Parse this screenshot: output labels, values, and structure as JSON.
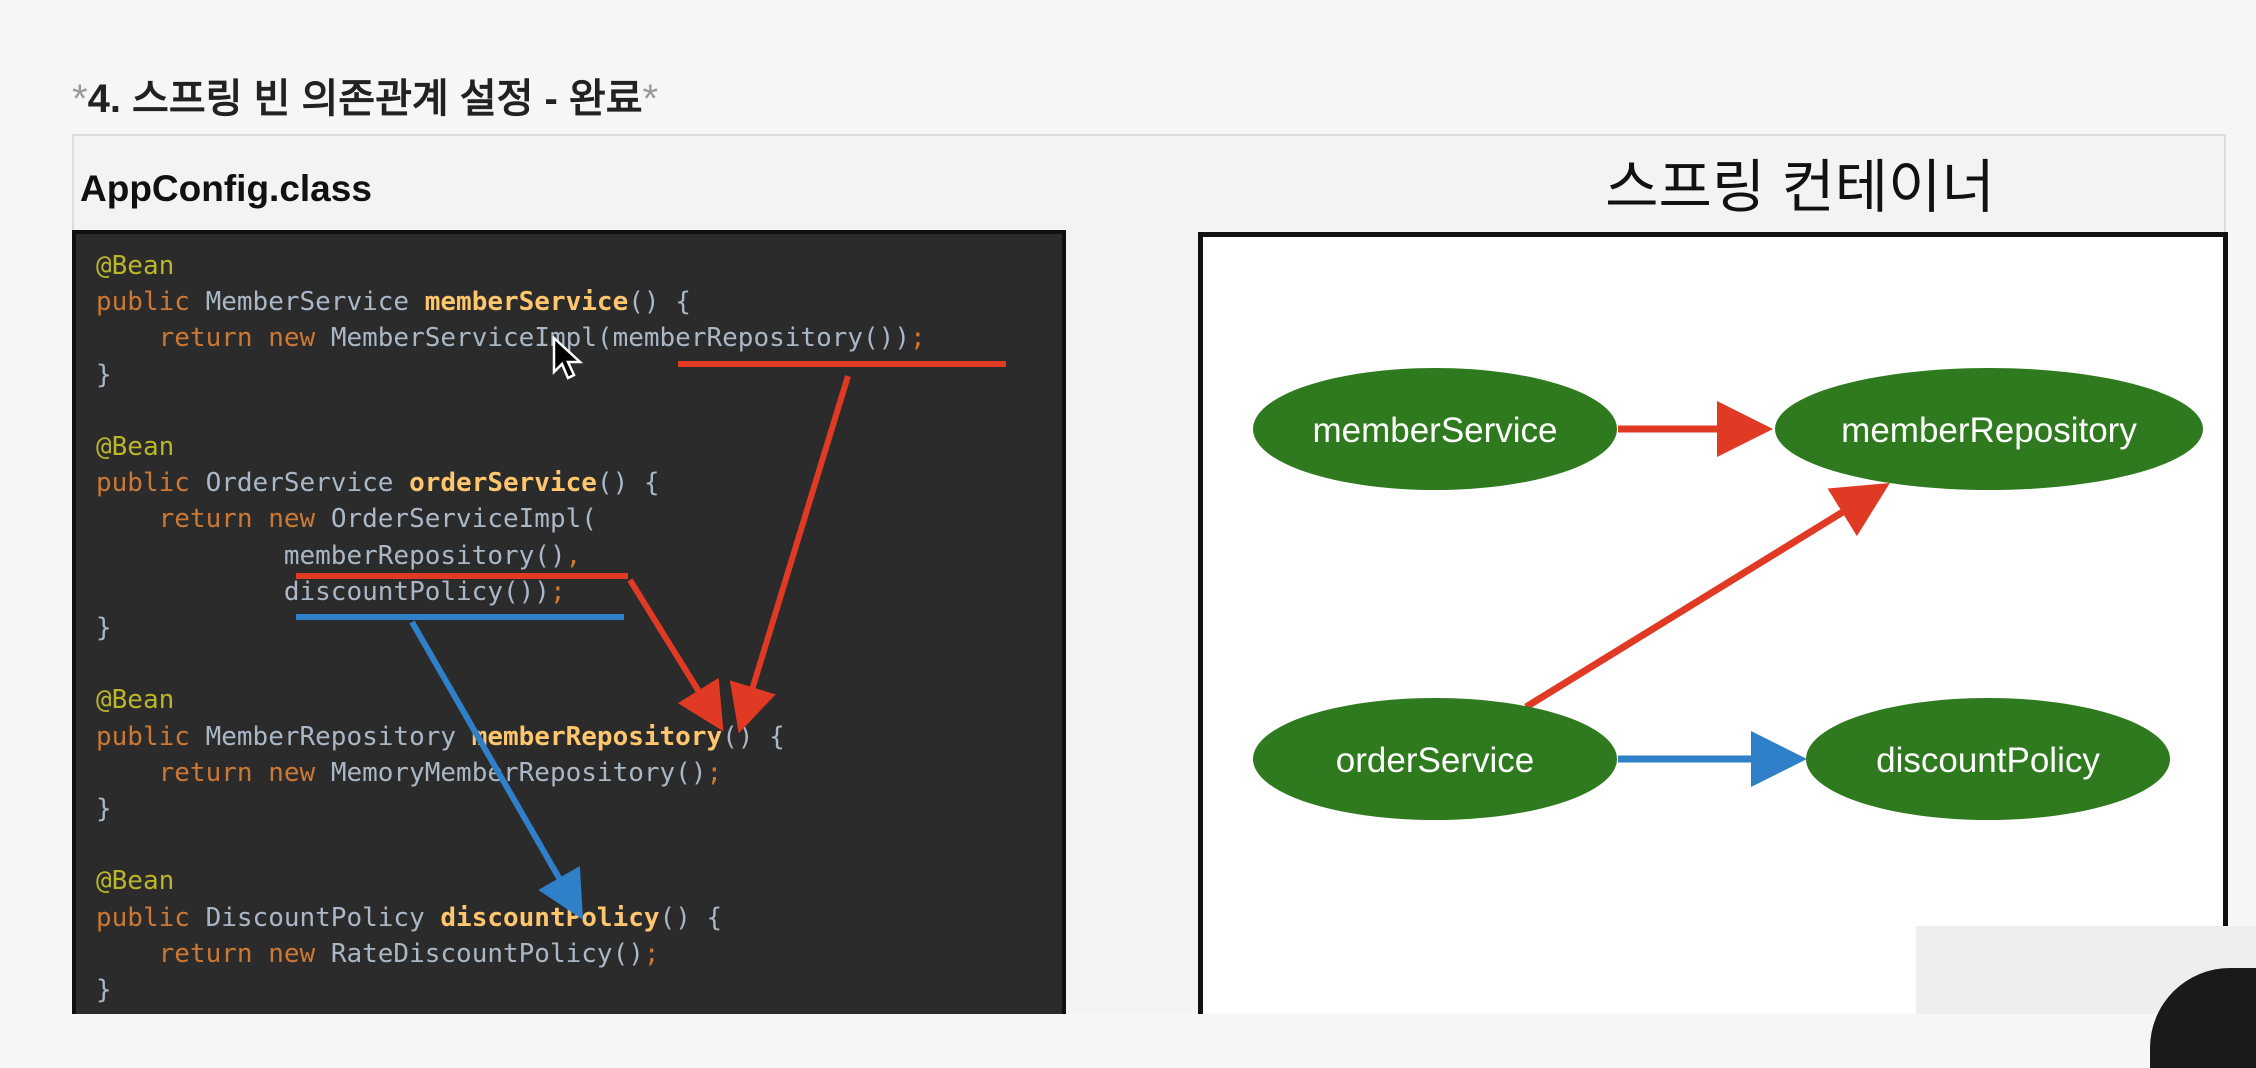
{
  "slide": {
    "heading_star_open": "*",
    "heading": "4. 스프링 빈 의존관계 설정 - 완료",
    "heading_star_close": "*",
    "left_title": "AppConfig.class",
    "right_title": "스프링 컨테이너"
  },
  "code_lines": [
    [
      [
        "ann",
        "@Bean"
      ]
    ],
    [
      [
        "kw",
        "public "
      ],
      [
        "id",
        "MemberService "
      ],
      [
        "fn",
        "memberService"
      ],
      [
        "id",
        "() {"
      ]
    ],
    [
      [
        "id",
        "    "
      ],
      [
        "kw",
        "return new "
      ],
      [
        "id",
        "MemberServiceImpl(memberRepository())"
      ],
      [
        "kw",
        ";"
      ]
    ],
    [
      [
        "id",
        "}"
      ]
    ],
    [
      [
        "id",
        ""
      ]
    ],
    [
      [
        "ann",
        "@Bean"
      ]
    ],
    [
      [
        "kw",
        "public "
      ],
      [
        "id",
        "OrderService "
      ],
      [
        "fn",
        "orderService"
      ],
      [
        "id",
        "() {"
      ]
    ],
    [
      [
        "id",
        "    "
      ],
      [
        "kw",
        "return new "
      ],
      [
        "id",
        "OrderServiceImpl("
      ]
    ],
    [
      [
        "id",
        "            memberRepository()"
      ],
      [
        "kw",
        ","
      ]
    ],
    [
      [
        "id",
        "            discountPolicy())"
      ],
      [
        "kw",
        ";"
      ]
    ],
    [
      [
        "id",
        "}"
      ]
    ],
    [
      [
        "id",
        ""
      ]
    ],
    [
      [
        "ann",
        "@Bean"
      ]
    ],
    [
      [
        "kw",
        "public "
      ],
      [
        "id",
        "MemberRepository "
      ],
      [
        "fn",
        "memberRepository"
      ],
      [
        "id",
        "() {"
      ]
    ],
    [
      [
        "id",
        "    "
      ],
      [
        "kw",
        "return new "
      ],
      [
        "id",
        "MemoryMemberRepository()"
      ],
      [
        "kw",
        ";"
      ]
    ],
    [
      [
        "id",
        "}"
      ]
    ],
    [
      [
        "id",
        ""
      ]
    ],
    [
      [
        "ann",
        "@Bean"
      ]
    ],
    [
      [
        "kw",
        "public "
      ],
      [
        "id",
        "DiscountPolicy "
      ],
      [
        "fn",
        "discountPolicy"
      ],
      [
        "id",
        "() {"
      ]
    ],
    [
      [
        "id",
        "    "
      ],
      [
        "kw",
        "return new "
      ],
      [
        "id",
        "RateDiscountPolicy()"
      ],
      [
        "kw",
        ";"
      ]
    ],
    [
      [
        "id",
        "}"
      ]
    ]
  ],
  "diagram": {
    "nodes": {
      "member_service": "memberService",
      "member_repository": "memberRepository",
      "order_service": "orderService",
      "discount_policy": "discountPolicy"
    },
    "edges": [
      {
        "from": "memberService",
        "to": "memberRepository",
        "color": "red"
      },
      {
        "from": "orderService",
        "to": "memberRepository",
        "color": "red"
      },
      {
        "from": "orderService",
        "to": "discountPolicy",
        "color": "blue"
      }
    ]
  },
  "colors": {
    "node_fill": "#2f7a1f",
    "dependency_red": "#e03a24",
    "dependency_blue": "#2f7fc9",
    "code_background": "#2b2b2b"
  }
}
